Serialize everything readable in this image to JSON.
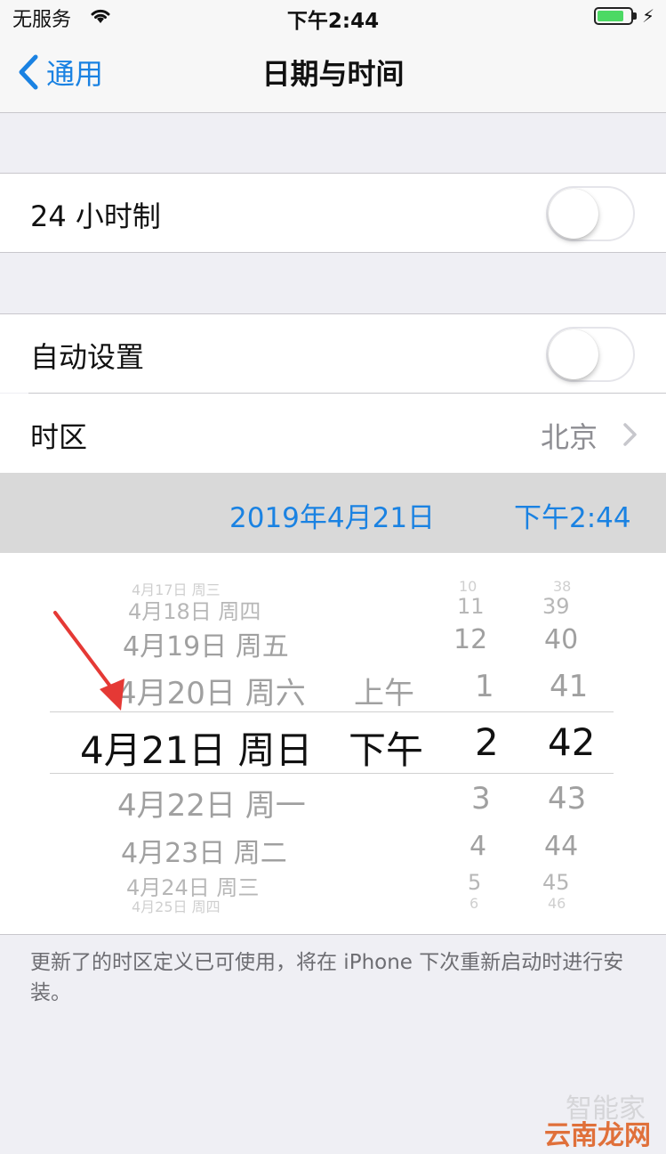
{
  "status_bar": {
    "carrier": "无服务",
    "time": "下午2:44",
    "wifi_icon": "wifi-icon",
    "battery_icon": "battery-icon",
    "battery_level": 0.8,
    "charging_icon": "bolt-icon"
  },
  "nav": {
    "back_label": "通用",
    "title": "日期与时间"
  },
  "settings": {
    "hour24_label": "24 小时制",
    "hour24_on": false,
    "auto_label": "自动设置",
    "auto_on": false,
    "timezone_label": "时区",
    "timezone_value": "北京"
  },
  "selected": {
    "date": "2019年4月21日",
    "time": "下午2:44"
  },
  "picker": {
    "dates": [
      "4月17日 周三",
      "4月18日 周四",
      "4月19日 周五",
      "4月20日 周六",
      "4月21日 周日",
      "4月22日 周一",
      "4月23日 周二",
      "4月24日 周三",
      "4月25日 周四"
    ],
    "ampm": [
      "上午",
      "下午"
    ],
    "hours": [
      "10",
      "11",
      "12",
      "1",
      "2",
      "3",
      "4",
      "5",
      "6"
    ],
    "minutes": [
      "38",
      "39",
      "40",
      "41",
      "42",
      "43",
      "44",
      "45",
      "46"
    ]
  },
  "footer_note": "更新了的时区定义已可使用，将在 iPhone 下次重新启动时进行安装。",
  "watermark": {
    "line1": "智能家",
    "line2": "云南龙网"
  },
  "colors": {
    "accent": "#1a82e2",
    "background": "#efeff4",
    "arrow": "#e53935"
  }
}
